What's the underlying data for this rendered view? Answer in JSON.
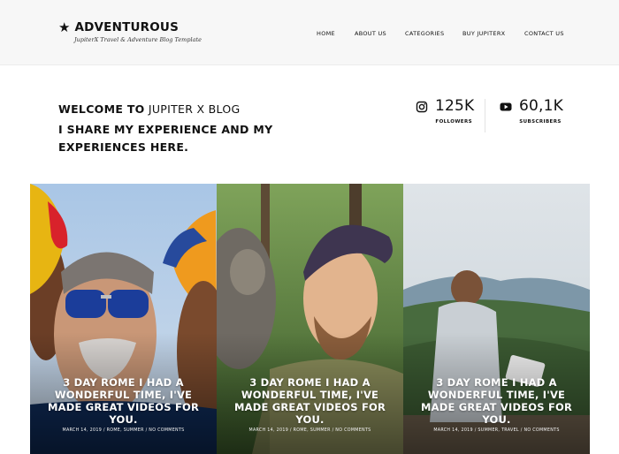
{
  "header": {
    "logo_name": "ADVENTUROUS",
    "logo_tagline": "JupiterX Travel & Adventure Blog Template",
    "nav": [
      "HOME",
      "ABOUT US",
      "CATEGORIES",
      "BUY JUPITERX",
      "CONTACT US"
    ]
  },
  "welcome": {
    "line1_bold": "WELCOME TO",
    "line1_regular": "JUPITER X BLOG",
    "line2": "I SHARE MY EXPERIENCE AND MY EXPERIENCES HERE."
  },
  "stats": [
    {
      "icon": "instagram-icon",
      "value": "125K",
      "label": "FOLLOWERS"
    },
    {
      "icon": "youtube-icon",
      "value": "60,1K",
      "label": "SUBSCRIBERS"
    }
  ],
  "posts": [
    {
      "title": "3 DAY ROME I HAD A WONDERFUL TIME, I'VE MADE GREAT VIDEOS FOR YOU.",
      "meta": "MARCH 14, 2019 / ROME, SUMMER / NO COMMENTS"
    },
    {
      "title": "3 DAY ROME I HAD A WONDERFUL TIME, I'VE MADE GREAT VIDEOS FOR YOU.",
      "meta": "MARCH 14, 2019 / ROME, SUMMER / NO COMMENTS"
    },
    {
      "title": "3 DAY ROME I HAD A WONDERFUL TIME, I'VE MADE GREAT VIDEOS FOR YOU.",
      "meta": "MARCH 14, 2019 / SUMMER, TRAVEL / NO COMMENTS"
    }
  ]
}
